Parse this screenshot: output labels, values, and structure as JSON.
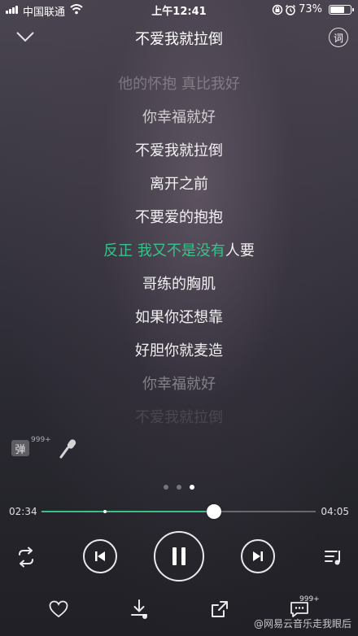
{
  "status_bar": {
    "carrier": "中国联通",
    "time": "上午12:41",
    "battery_pct": "73%",
    "battery_level": 0.73,
    "icons": [
      "signal-icon",
      "wifi-icon",
      "orientation-lock-icon",
      "alarm-icon",
      "battery-icon"
    ]
  },
  "header": {
    "title": "不爱我就拉倒",
    "lyrics_button": "词"
  },
  "lyrics": {
    "lines": [
      "他的怀抱 真比我好",
      "你幸福就好",
      "不爱我就拉倒",
      "离开之前",
      "不要爱的抱抱",
      "人要",
      "哥练的胸肌",
      "如果你还想靠",
      "好胆你就麦造",
      "你幸福就好",
      "不爱我就拉倒"
    ],
    "current_line_sung": "反正 我又不是没有",
    "current_line_rest": "人要",
    "highlight_color": "#38c28a"
  },
  "side_actions": {
    "danmu_label": "弹",
    "danmu_count": "999+"
  },
  "pager": {
    "count": 3,
    "active_index": 2
  },
  "progress": {
    "current_time": "02:34",
    "total_time": "04:05",
    "played_fraction": 0.63,
    "buffer_marker_fraction": 0.225
  },
  "bottom": {
    "comment_count": "999+",
    "watermark": "@网易云音乐走我眼后"
  }
}
